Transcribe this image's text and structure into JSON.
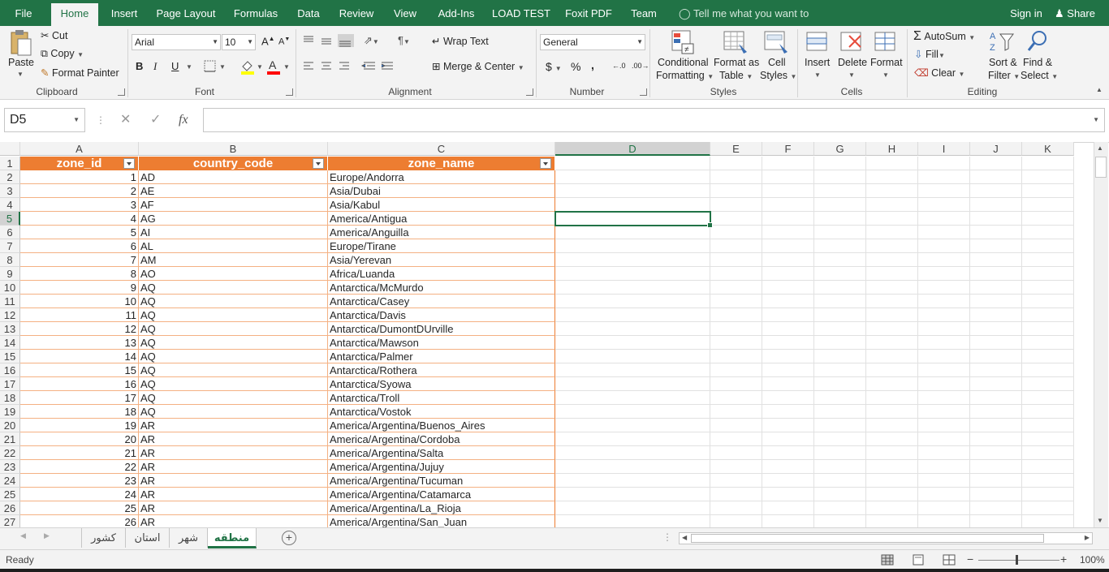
{
  "menu": {
    "file": "File",
    "home": "Home",
    "insert": "Insert",
    "page_layout": "Page Layout",
    "formulas": "Formulas",
    "data": "Data",
    "review": "Review",
    "view": "View",
    "addins": "Add-Ins",
    "load_test": "LOAD TEST",
    "foxit": "Foxit PDF",
    "team": "Team",
    "tell_me": "Tell me what you want to do...",
    "sign_in": "Sign in",
    "share": "Share"
  },
  "ribbon": {
    "clipboard": {
      "paste": "Paste",
      "cut": "Cut",
      "copy": "Copy",
      "format_painter": "Format Painter",
      "label": "Clipboard"
    },
    "font": {
      "name": "Arial",
      "size": "10",
      "bold": "B",
      "italic": "I",
      "underline": "U",
      "label": "Font"
    },
    "alignment": {
      "wrap_text": "Wrap Text",
      "merge_center": "Merge & Center",
      "label": "Alignment"
    },
    "number": {
      "format": "General",
      "currency": "$",
      "percent": "%",
      "comma": ",",
      "label": "Number"
    },
    "styles": {
      "conditional": "Conditional",
      "formatting": "Formatting",
      "format_as": "Format as",
      "table": "Table",
      "cell": "Cell",
      "cell_styles": "Styles",
      "label": "Styles"
    },
    "cells": {
      "insert": "Insert",
      "delete": "Delete",
      "format": "Format",
      "label": "Cells"
    },
    "editing": {
      "autosum": "AutoSum",
      "fill": "Fill",
      "clear": "Clear",
      "sort": "Sort &",
      "filter": "Filter",
      "find": "Find &",
      "select": "Select",
      "label": "Editing"
    }
  },
  "formula_bar": {
    "name_box": "D5",
    "fx": "fx",
    "value": ""
  },
  "columns": [
    "A",
    "B",
    "C",
    "D",
    "E",
    "F",
    "G",
    "H",
    "I",
    "J",
    "K"
  ],
  "headers": [
    "zone_id",
    "country_code",
    "zone_name"
  ],
  "rows": [
    [
      "1",
      "AD",
      "Europe/Andorra"
    ],
    [
      "2",
      "AE",
      "Asia/Dubai"
    ],
    [
      "3",
      "AF",
      "Asia/Kabul"
    ],
    [
      "4",
      "AG",
      "America/Antigua"
    ],
    [
      "5",
      "AI",
      "America/Anguilla"
    ],
    [
      "6",
      "AL",
      "Europe/Tirane"
    ],
    [
      "7",
      "AM",
      "Asia/Yerevan"
    ],
    [
      "8",
      "AO",
      "Africa/Luanda"
    ],
    [
      "9",
      "AQ",
      "Antarctica/McMurdo"
    ],
    [
      "10",
      "AQ",
      "Antarctica/Casey"
    ],
    [
      "11",
      "AQ",
      "Antarctica/Davis"
    ],
    [
      "12",
      "AQ",
      "Antarctica/DumontDUrville"
    ],
    [
      "13",
      "AQ",
      "Antarctica/Mawson"
    ],
    [
      "14",
      "AQ",
      "Antarctica/Palmer"
    ],
    [
      "15",
      "AQ",
      "Antarctica/Rothera"
    ],
    [
      "16",
      "AQ",
      "Antarctica/Syowa"
    ],
    [
      "17",
      "AQ",
      "Antarctica/Troll"
    ],
    [
      "18",
      "AQ",
      "Antarctica/Vostok"
    ],
    [
      "19",
      "AR",
      "America/Argentina/Buenos_Aires"
    ],
    [
      "20",
      "AR",
      "America/Argentina/Cordoba"
    ],
    [
      "21",
      "AR",
      "America/Argentina/Salta"
    ],
    [
      "22",
      "AR",
      "America/Argentina/Jujuy"
    ],
    [
      "23",
      "AR",
      "America/Argentina/Tucuman"
    ],
    [
      "24",
      "AR",
      "America/Argentina/Catamarca"
    ],
    [
      "25",
      "AR",
      "America/Argentina/La_Rioja"
    ],
    [
      "26",
      "AR",
      "America/Argentina/San_Juan"
    ]
  ],
  "row_numbers": [
    "1",
    "2",
    "3",
    "4",
    "5",
    "6",
    "7",
    "8",
    "9",
    "10",
    "11",
    "12",
    "13",
    "14",
    "15",
    "16",
    "17",
    "18",
    "19",
    "20",
    "21",
    "22",
    "23",
    "24",
    "25",
    "26",
    "27"
  ],
  "sheets": [
    "کشور",
    "استان",
    "شهر",
    "منطقه"
  ],
  "active_sheet": "منطقه",
  "status": {
    "ready": "Ready",
    "zoom": "100%"
  },
  "colors": {
    "excel_green": "#217346",
    "header_orange": "#ed7d31",
    "row_border": "#f4b183"
  }
}
